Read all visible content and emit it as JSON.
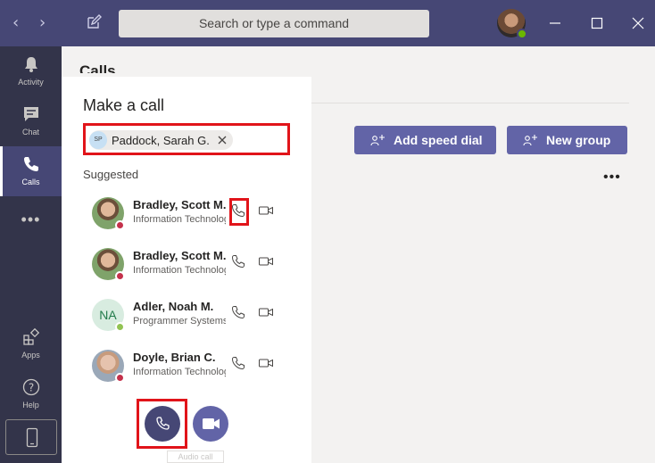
{
  "titlebar": {
    "search_placeholder": "Search or type a command",
    "back_icon": "chevron-left-icon",
    "forward_icon": "chevron-right-icon"
  },
  "rail": {
    "items": [
      {
        "label": "Activity",
        "icon": "bell-icon"
      },
      {
        "label": "Chat",
        "icon": "chat-icon"
      },
      {
        "label": "Calls",
        "icon": "phone-icon",
        "active": true
      },
      {
        "label": "Apps",
        "icon": "apps-icon"
      },
      {
        "label": "Help",
        "icon": "help-icon"
      }
    ],
    "more": "•••"
  },
  "calls": {
    "header": "Calls",
    "popup": {
      "title": "Make a call",
      "recipient": {
        "initials": "SP",
        "name": "Paddock, Sarah G."
      },
      "suggested_label": "Suggested",
      "contacts": [
        {
          "name": "Bradley, Scott M.",
          "subtitle": "Information Technology",
          "status": "busy"
        },
        {
          "name": "Bradley, Scott M.",
          "subtitle": "Information Technology",
          "status": "busy"
        },
        {
          "name": "Adler, Noah M.",
          "initials": "NA",
          "subtitle": "Programmer Systems",
          "status": "available"
        },
        {
          "name": "Doyle, Brian C.",
          "subtitle": "Information Technology",
          "status": "busy"
        }
      ],
      "tooltip": "Audio call"
    }
  },
  "main": {
    "add_speed_dial": "Add speed dial",
    "new_group": "New group",
    "more": "•••"
  },
  "colors": {
    "brand": "#464775",
    "accent": "#6264a7",
    "highlight": "#e1141a",
    "busy": "#c4314b",
    "available": "#92c353"
  }
}
